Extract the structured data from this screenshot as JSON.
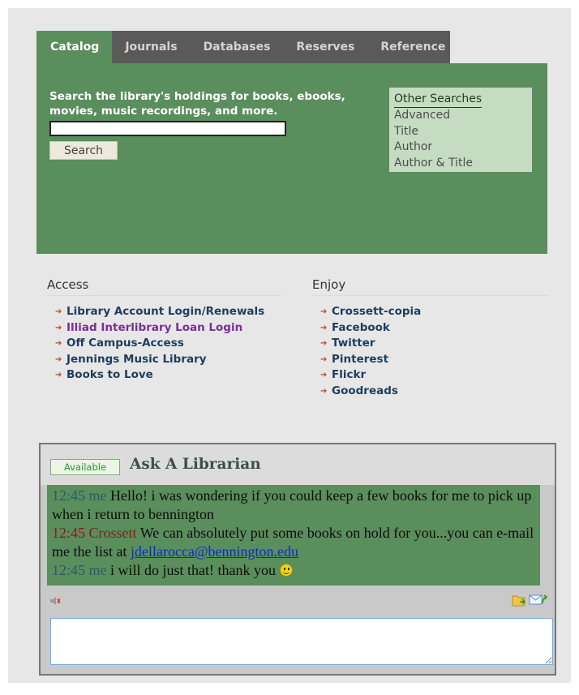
{
  "tabs": [
    {
      "label": "Catalog",
      "active": true
    },
    {
      "label": "Journals",
      "active": false
    },
    {
      "label": "Databases",
      "active": false
    },
    {
      "label": "Reserves",
      "active": false
    },
    {
      "label": "Reference",
      "active": false
    }
  ],
  "catalog": {
    "description": "Search the library's holdings for books, ebooks, movies, music recordings, and more.",
    "search_value": "",
    "search_button": "Search"
  },
  "other_searches": {
    "title": "Other Searches",
    "items": [
      "Advanced",
      "Title",
      "Author",
      "Author & Title"
    ]
  },
  "access": {
    "title": "Access",
    "items": [
      "Library Account Login/Renewals",
      "Illiad Interlibrary Loan Login",
      "Off Campus-Access",
      "Jennings Music Library",
      "Books to Love"
    ]
  },
  "enjoy": {
    "title": "Enjoy",
    "items": [
      "Crossett-copia",
      "Facebook",
      "Twitter",
      "Pinterest",
      "Flickr",
      "Goodreads"
    ]
  },
  "chat": {
    "status": "Available",
    "title": "Ask A Librarian",
    "messages": [
      {
        "time": "12:45",
        "sender": "me",
        "text": "Hello! i was wondering if you could keep a few books for me to pick up when i return to bennington"
      },
      {
        "time": "12:45",
        "sender": "Crossett",
        "text": "We can absolutely put some books on hold for you...you can e-mail me the list at",
        "email": "jdellarocca@bennington.edu"
      },
      {
        "time": "12:45",
        "sender": "me",
        "text": "i will do just that! thank you"
      }
    ],
    "input_value": ""
  },
  "colors": {
    "panel_green": "#5a8e5c",
    "tab_bar": "#5a5a5a",
    "other_searches_bg": "#c5dcc2",
    "link_navy": "#1f3d5f",
    "link_purple": "#7a2e9a",
    "bullet_red": "#c8442b"
  },
  "icons": {
    "bullet": "arrow-bullet-icon",
    "sound": "speaker-icon",
    "send_file": "folder-send-icon",
    "email": "email-transcript-icon",
    "emoticon": "smiley-icon"
  }
}
